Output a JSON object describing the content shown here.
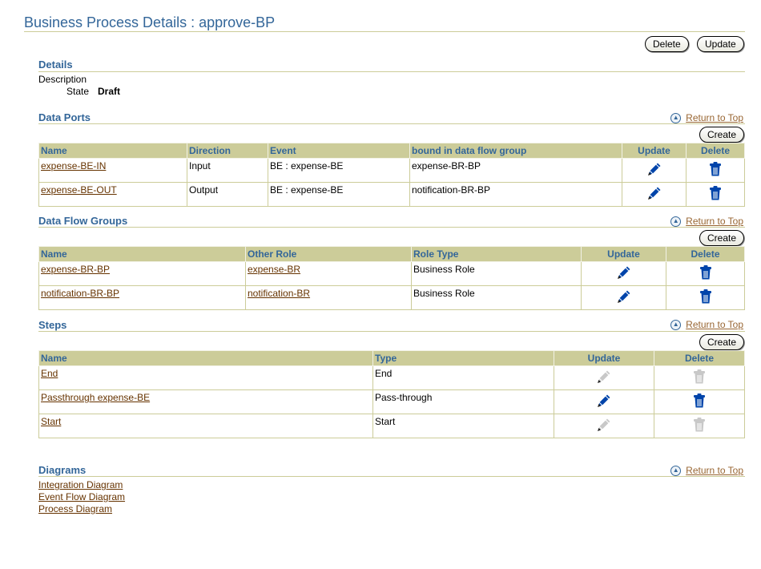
{
  "page": {
    "title": "Business Process Details : approve-BP"
  },
  "toolbar": {
    "delete_label": "Delete",
    "update_label": "Update"
  },
  "details": {
    "title": "Details",
    "description_label": "Description",
    "state_label": "State",
    "state_value": "Draft"
  },
  "common": {
    "return_to_top": "Return to Top",
    "create_label": "Create"
  },
  "data_ports": {
    "title": "Data Ports",
    "headers": [
      "Name",
      "Direction",
      "Event",
      "bound in data flow group",
      "Update",
      "Delete"
    ],
    "rows": [
      {
        "name": "expense-BE-IN",
        "direction": "Input",
        "event": "BE : expense-BE",
        "group": "expense-BR-BP"
      },
      {
        "name": "expense-BE-OUT",
        "direction": "Output",
        "event": "BE : expense-BE",
        "group": "notification-BR-BP"
      }
    ]
  },
  "data_flow_groups": {
    "title": "Data Flow Groups",
    "headers": [
      "Name",
      "Other Role",
      "Role Type",
      "Update",
      "Delete"
    ],
    "rows": [
      {
        "name": "expense-BR-BP",
        "other_role": "expense-BR",
        "role_type": "Business Role"
      },
      {
        "name": "notification-BR-BP",
        "other_role": "notification-BR",
        "role_type": "Business Role"
      }
    ]
  },
  "steps": {
    "title": "Steps",
    "headers": [
      "Name",
      "Type",
      "Update",
      "Delete"
    ],
    "rows": [
      {
        "name": "End",
        "type": "End"
      },
      {
        "name": "Passthrough expense-BE",
        "type": "Pass-through"
      },
      {
        "name": "Start",
        "type": "Start"
      }
    ]
  },
  "diagrams": {
    "title": "Diagrams",
    "links": [
      "Integration Diagram",
      "Event Flow Diagram",
      "Process Diagram"
    ]
  },
  "colors": {
    "title_blue": "#336699",
    "header_bg": "#cccc99",
    "link_brown": "#663300",
    "icon_blue": "#0044aa",
    "icon_disabled": "#c8c8c8"
  },
  "icons": {
    "update": "pencil-icon",
    "delete": "trash-icon",
    "return_to_top": "up-arrow-icon"
  }
}
